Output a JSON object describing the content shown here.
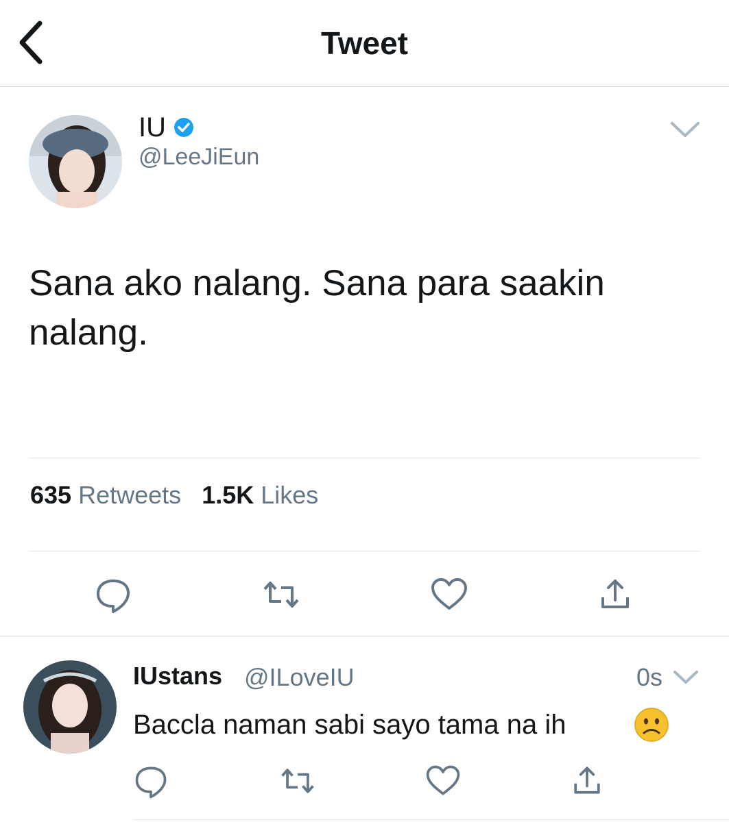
{
  "header": {
    "title": "Tweet"
  },
  "tweet": {
    "name": "IU",
    "handle": "@LeeJiEun",
    "text": "Sana ako nalang. Sana para saakin nalang.",
    "retweet_count": "635",
    "retweet_label": "Retweets",
    "like_count": "1.5K",
    "like_label": "Likes"
  },
  "reply": {
    "name": "IUstans",
    "handle": "@ILoveIU",
    "time": "0s",
    "text": "Baccla naman sabi sayo tama na ih",
    "emoji": "☹"
  },
  "colors": {
    "accent": "#1da1f2",
    "icon": "#657786",
    "divider": "#e1e8ed"
  },
  "icons": [
    "back-chevron-icon",
    "verified-badge-icon",
    "chevron-down-icon",
    "reply-icon",
    "retweet-icon",
    "like-icon",
    "share-icon",
    "frowning-face-emoji"
  ]
}
